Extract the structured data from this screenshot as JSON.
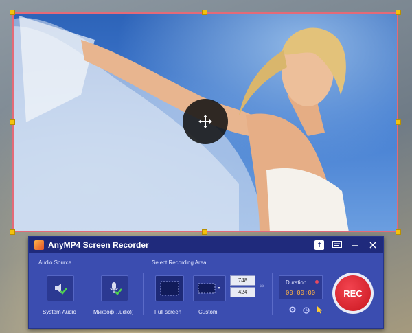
{
  "app": {
    "title": "AnyMP4 Screen Recorder"
  },
  "sections": {
    "audio_source": "Audio Source",
    "recording_area": "Select Recording Area"
  },
  "audio": {
    "system_audio": "System Audio",
    "microphone": "Микроф…udio))"
  },
  "area": {
    "full_screen": "Full screen",
    "custom": "Custom",
    "width": "748",
    "height": "424"
  },
  "duration": {
    "label": "Duration",
    "time": "00:00:00"
  },
  "rec": {
    "label": "REC"
  },
  "colors": {
    "panel": "#3b4db0",
    "titlebar": "#1f2a7c",
    "rec_button": "#d9222d",
    "frame": "#e46a78",
    "handle": "#f4c20d"
  },
  "icons": [
    "facebook-icon",
    "feedback-icon",
    "minimize-icon",
    "close-icon",
    "move-icon",
    "speaker-icon",
    "microphone-icon",
    "gear-icon",
    "alarm-icon",
    "cursor-icon",
    "link-icon"
  ]
}
